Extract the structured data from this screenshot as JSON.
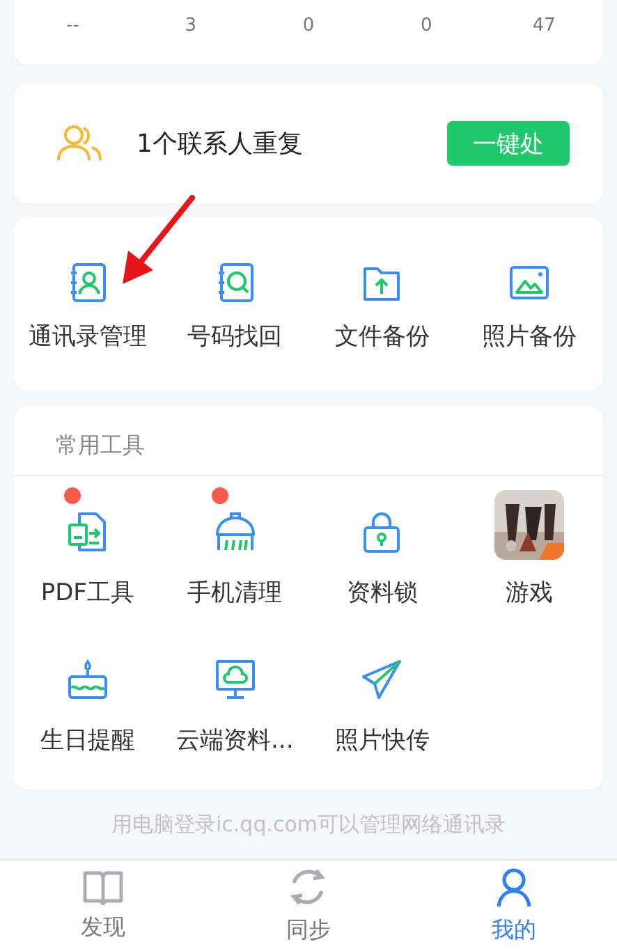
{
  "stats": [
    {
      "value": "--"
    },
    {
      "value": "3"
    },
    {
      "value": "0"
    },
    {
      "value": "0"
    },
    {
      "value": "47"
    }
  ],
  "duplicate": {
    "message": "1个联系人重复",
    "button": "一键处"
  },
  "main_tools": [
    {
      "label": "通讯录管理"
    },
    {
      "label": "号码找回"
    },
    {
      "label": "文件备份"
    },
    {
      "label": "照片备份"
    }
  ],
  "common_tools": {
    "title": "常用工具",
    "items": [
      {
        "label": "PDF工具",
        "badge": true
      },
      {
        "label": "手机清理",
        "badge": true
      },
      {
        "label": "资料锁",
        "badge": false
      },
      {
        "label": "游戏",
        "badge": false,
        "kind": "picture"
      },
      {
        "label": "生日提醒",
        "badge": false
      },
      {
        "label": "云端资料...",
        "badge": false
      },
      {
        "label": "照片快传",
        "badge": false
      }
    ]
  },
  "footer": "用电脑登录ic.qq.com可以管理网络通讯录",
  "tab_bar": [
    {
      "label": "发现",
      "selected": false
    },
    {
      "label": "同步",
      "selected": false
    },
    {
      "label": "我的",
      "selected": true
    }
  ]
}
